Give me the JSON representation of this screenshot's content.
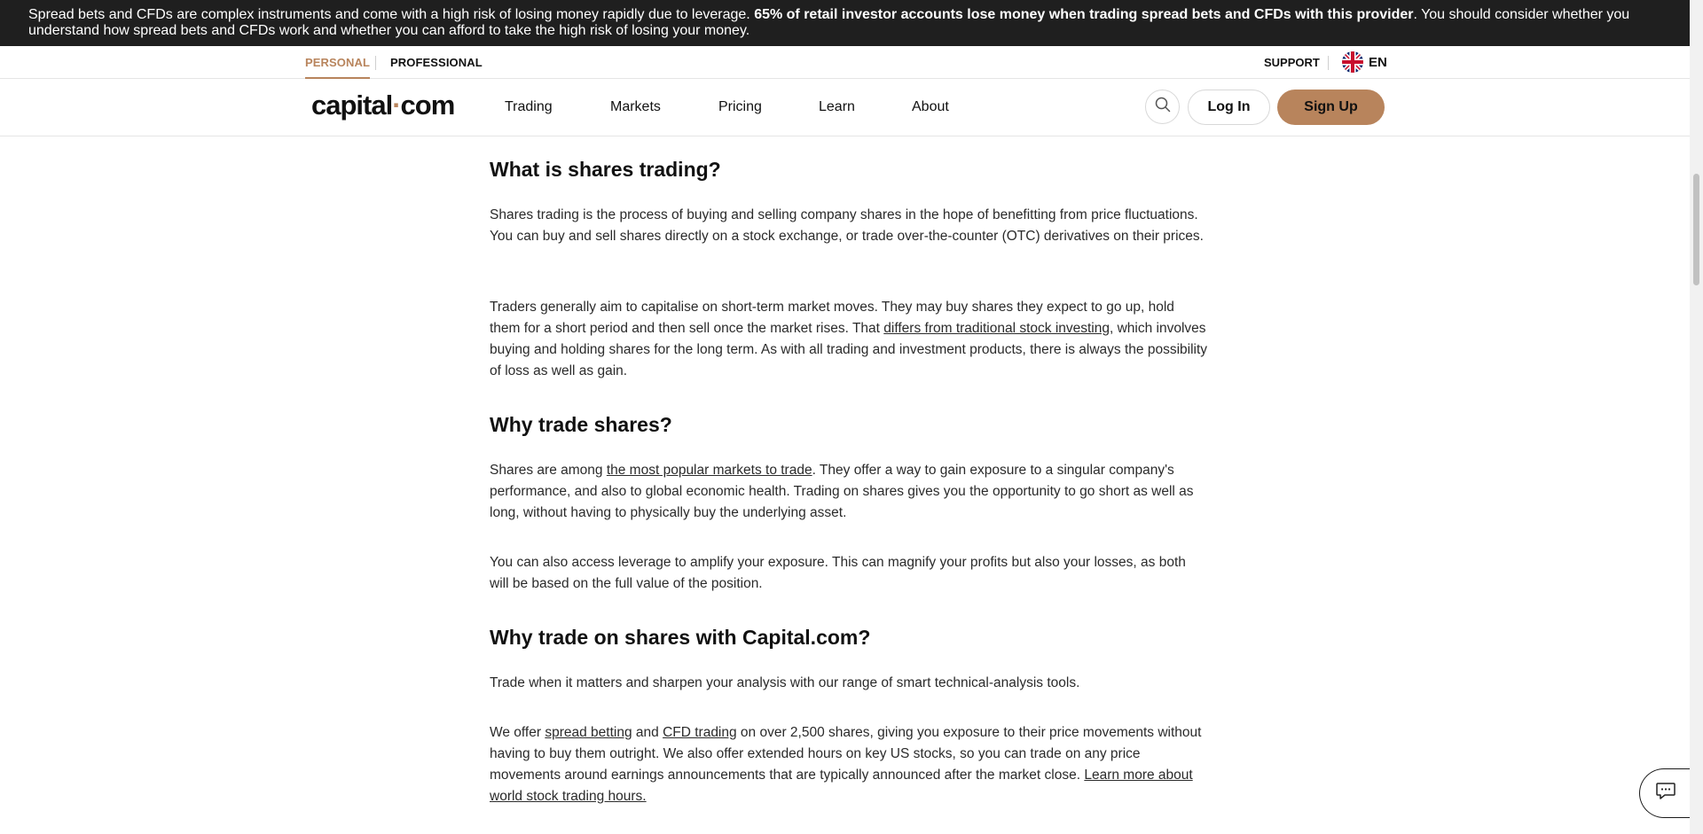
{
  "risk_banner": {
    "text_before": "Spread bets and CFDs are complex instruments and come with a high risk of losing money rapidly due to leverage. ",
    "text_bold": "65% of retail investor accounts lose money when trading spread bets and CFDs with this provider",
    "text_after": ". You should consider whether you understand how spread bets and CFDs work and whether you can afford to take the high risk of losing your money."
  },
  "topbar": {
    "personal": "PERSONAL",
    "professional": "PROFESSIONAL",
    "support": "SUPPORT",
    "language": "EN",
    "flag_icon": "uk-flag-icon"
  },
  "nav": {
    "logo_left": "capital",
    "logo_dot": "·",
    "logo_right": "com",
    "items": [
      "Trading",
      "Markets",
      "Pricing",
      "Learn",
      "About"
    ],
    "search_icon": "search-icon",
    "login": "Log In",
    "signup": "Sign Up"
  },
  "article": {
    "h1": "What is shares trading?",
    "p1": "Shares trading is the process of buying and selling company shares in the hope of benefitting from price fluctuations. You can buy and sell shares directly on a stock exchange, or trade over-the-counter (OTC) derivatives on their prices.",
    "p2_a": "Traders generally aim to capitalise on short-term market moves. They may buy shares they expect to go up, hold them for a short period and then sell once the market rises. That ",
    "p2_link": "differs from traditional stock investing",
    "p2_b": ", which involves buying and holding shares for the long term. As with all trading and investment products, there is always the possibility of loss as well as gain.",
    "h2": "Why trade shares?",
    "p3_a": "Shares are among ",
    "p3_link": "the most popular markets to trade",
    "p3_b": ". They offer a way to gain exposure to a singular company's performance, and also to global economic health. Trading on shares gives you the opportunity to go short as well as long, without having to physically buy the underlying asset.",
    "p4": "You can also access leverage to amplify your exposure. This can magnify your profits but also your losses, as both will be based on the full value of the position.",
    "h3": "Why trade on shares with Capital.com?",
    "p5": "Trade when it matters and sharpen your analysis with our range of smart technical-analysis tools.",
    "p6_a": "We offer ",
    "p6_link1": "spread betting",
    "p6_b": " and ",
    "p6_link2": "CFD trading",
    "p6_c": " on over 2,500 shares, giving you exposure to their price movements without having to buy them outright. We also offer extended hours on key US stocks, so you can trade on any price movements around earnings announcements that are typically announced after the market close. ",
    "p6_link3": "Learn more about world stock trading hours."
  },
  "chat": {
    "icon": "chat-icon"
  },
  "colors": {
    "accent": "#b8845c",
    "banner_bg": "#1f1f1f"
  }
}
